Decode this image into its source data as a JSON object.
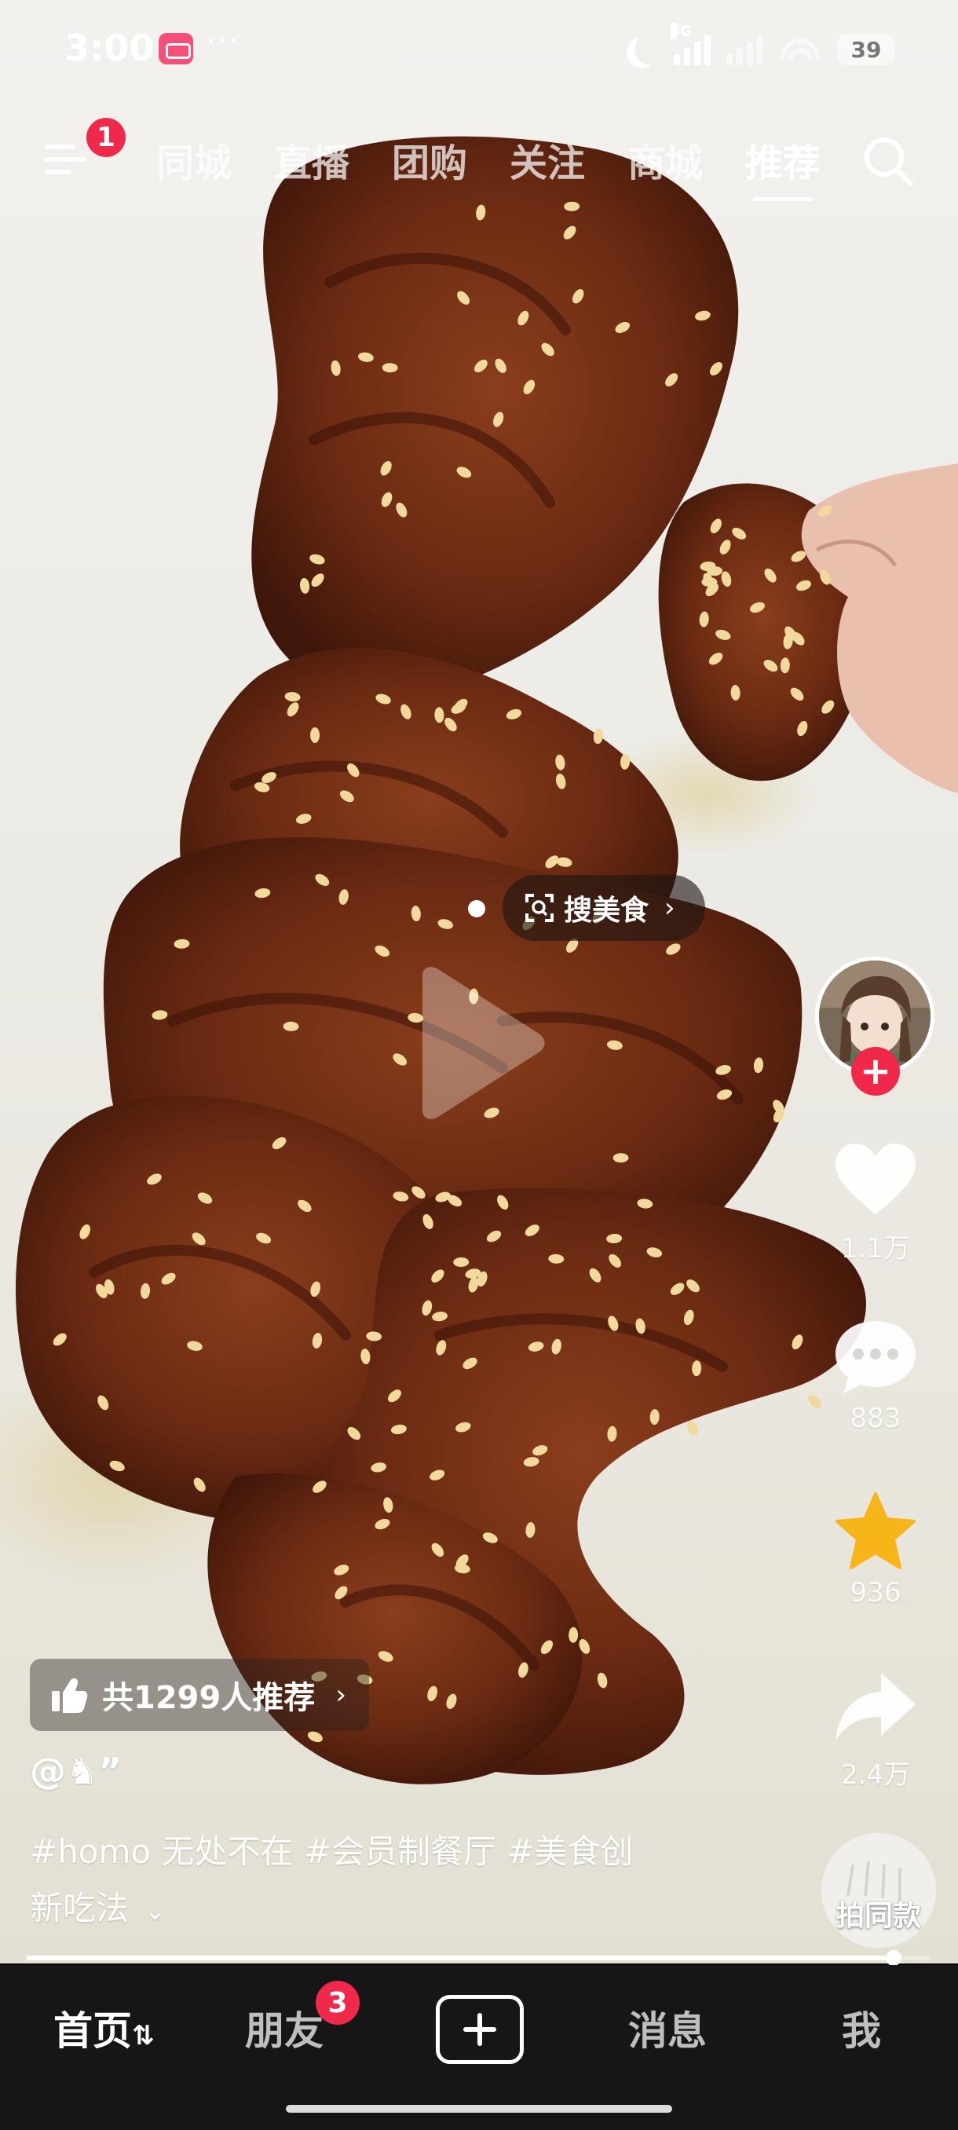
{
  "status_bar": {
    "time": "3:00",
    "dots": "···",
    "network_tag": "5G",
    "battery": "39"
  },
  "top_nav": {
    "menu_badge": "1",
    "tabs": [
      "同城",
      "直播",
      "团购",
      "关注",
      "商城",
      "推荐"
    ],
    "active_tab": "推荐"
  },
  "overlay": {
    "search_label": "搜美食"
  },
  "rail": {
    "likes": "1.1万",
    "comments": "883",
    "favorites": "936",
    "shares": "2.4万",
    "same_style_label": "拍同款"
  },
  "info": {
    "recommend_text": "共1299人推荐",
    "author": "@♞”",
    "caption_line1": "#homo 无处不在 #会员制餐厅 #美食创",
    "caption_line2": "新吃法",
    "progress": 0.96
  },
  "bottom_nav": {
    "home": "首页",
    "home_suffix": "⇅",
    "friends": "朋友",
    "friends_badge": "3",
    "messages": "消息",
    "me": "我"
  },
  "colors": {
    "badge_red": "#f0284a",
    "favorite_gold": "#f7b51a",
    "bar_bg": "#161616"
  }
}
